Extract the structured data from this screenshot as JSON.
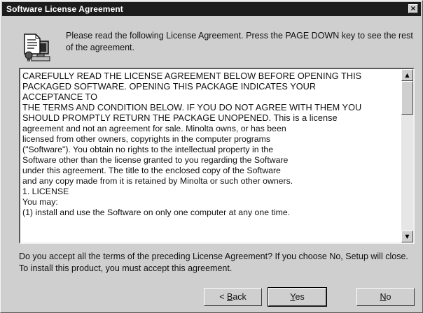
{
  "window": {
    "title": "Software License Agreement",
    "close_glyph": "×"
  },
  "icon": {
    "name": "license-document-computer-icon"
  },
  "intro": "Please read the following License Agreement. Press the PAGE DOWN key to see the rest of the agreement.",
  "license": {
    "lines": [
      "CAREFULLY READ THE LICENSE AGREEMENT BELOW BEFORE OPENING THIS",
      "PACKAGED SOFTWARE. OPENING THIS PACKAGE INDICATES YOUR",
      "ACCEPTANCE TO",
      "THE TERMS AND CONDITION BELOW. IF YOU DO NOT AGREE WITH THEM YOU",
      "SHOULD PROMPTLY RETURN THE PACKAGE UNOPENED. This is a license",
      "agreement and not an agreement for sale. Minolta owns, or has been",
      "licensed from other owners, copyrights in the computer programs",
      "(\"Software\"). You obtain no rights to the intellectual property in the",
      "Software other than the license granted to you regarding the Software",
      "under this agreement. The title to the enclosed copy of the Software",
      "and any copy made from it is retained by Minolta or such other owners.",
      "1. LICENSE",
      "You may:",
      "(1) install and use the Software on only one computer at any one time."
    ]
  },
  "scrollbar": {
    "up_glyph": "▲",
    "down_glyph": "▼"
  },
  "question": "Do you accept all the terms of the preceding License Agreement? If you choose No, Setup will close. To install this product, you must accept this agreement.",
  "buttons": {
    "back": {
      "prefix": "< ",
      "mnemonic": "B",
      "rest": "ack"
    },
    "yes": {
      "mnemonic": "Y",
      "rest": "es"
    },
    "no": {
      "mnemonic": "N",
      "rest": "o"
    }
  }
}
